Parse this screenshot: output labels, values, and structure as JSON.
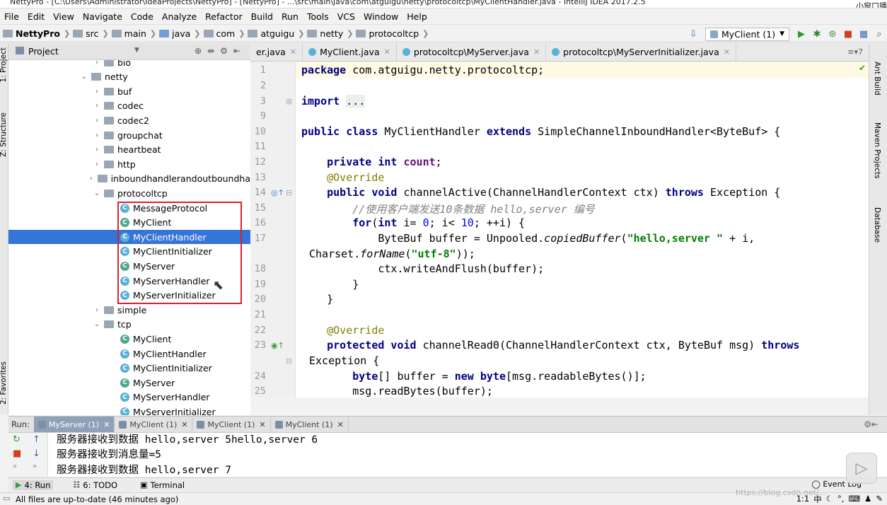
{
  "window": {
    "title": "NettyPro - [C:\\Users\\Administrator\\IdeaProjects\\NettyPro] - [NettyPro] - ...\\src\\main\\java\\com\\atguigu\\netty\\protocoltcp\\MyClientHandler.java - IntelliJ IDEA 2017.2.5",
    "corner_label": "小窗口播"
  },
  "menu": [
    "File",
    "Edit",
    "View",
    "Navigate",
    "Code",
    "Analyze",
    "Refactor",
    "Build",
    "Run",
    "Tools",
    "VCS",
    "Window",
    "Help"
  ],
  "breadcrumb": [
    "NettyPro",
    "src",
    "main",
    "java",
    "com",
    "atguigu",
    "netty",
    "protocoltcp"
  ],
  "toolbar": {
    "run_config": "MyClient (1)"
  },
  "left_tools": {
    "project_tab": "1: Project",
    "structure_tab": "Z: Structure",
    "favorites_tab": "2: Favorites"
  },
  "project_panel": {
    "title": "Project",
    "tree": [
      {
        "label": "bio",
        "type": "folder",
        "depth": 2,
        "expanded": false
      },
      {
        "label": "netty",
        "type": "folder",
        "depth": 1,
        "expanded": true
      },
      {
        "label": "buf",
        "type": "folder",
        "depth": 2,
        "expanded": false
      },
      {
        "label": "codec",
        "type": "folder",
        "depth": 2,
        "expanded": false
      },
      {
        "label": "codec2",
        "type": "folder",
        "depth": 2,
        "expanded": false
      },
      {
        "label": "groupchat",
        "type": "folder",
        "depth": 2,
        "expanded": false
      },
      {
        "label": "heartbeat",
        "type": "folder",
        "depth": 2,
        "expanded": false
      },
      {
        "label": "http",
        "type": "folder",
        "depth": 2,
        "expanded": false
      },
      {
        "label": "inboundhandlerandoutboundha",
        "type": "folder",
        "depth": 2,
        "expanded": false
      },
      {
        "label": "protocoltcp",
        "type": "folder",
        "depth": 2,
        "expanded": true
      },
      {
        "label": "MessageProtocol",
        "type": "class",
        "depth": 3
      },
      {
        "label": "MyClient",
        "type": "runclass",
        "depth": 3
      },
      {
        "label": "MyClientHandler",
        "type": "class",
        "depth": 3,
        "selected": true
      },
      {
        "label": "MyClientInitializer",
        "type": "class",
        "depth": 3
      },
      {
        "label": "MyServer",
        "type": "runclass",
        "depth": 3
      },
      {
        "label": "MyServerHandler",
        "type": "class",
        "depth": 3
      },
      {
        "label": "MyServerInitializer",
        "type": "class",
        "depth": 3
      },
      {
        "label": "simple",
        "type": "folder",
        "depth": 2,
        "expanded": false
      },
      {
        "label": "tcp",
        "type": "folder",
        "depth": 2,
        "expanded": true
      },
      {
        "label": "MyClient",
        "type": "runclass",
        "depth": 3
      },
      {
        "label": "MyClientHandler",
        "type": "class",
        "depth": 3
      },
      {
        "label": "MyClientInitializer",
        "type": "class",
        "depth": 3
      },
      {
        "label": "MyServer",
        "type": "runclass",
        "depth": 3
      },
      {
        "label": "MyServerHandler",
        "type": "class",
        "depth": 3
      },
      {
        "label": "MyServerInitializer",
        "type": "class",
        "depth": 3
      }
    ]
  },
  "editor_tabs": [
    {
      "label": "er.java",
      "active": false
    },
    {
      "label": "MyClient.java",
      "active": false
    },
    {
      "label": "protocoltcp\\MyServer.java",
      "active": false
    },
    {
      "label": "protocoltcp\\MyServerInitializer.java",
      "active": false
    }
  ],
  "editor": {
    "line_numbers": [
      "1",
      "2",
      "3",
      "9",
      "10",
      "11",
      "12",
      "13",
      "14",
      "15",
      "16",
      "17",
      "",
      "18",
      "19",
      "20",
      "21",
      "22",
      "23",
      "",
      "24",
      "25"
    ]
  },
  "right_tools": [
    "Ant Build",
    "Maven Projects",
    "Database"
  ],
  "run_panel": {
    "label": "Run:",
    "tabs": [
      "MyServer (1)",
      "MyClient (1)",
      "MyClient (1)",
      "MyClient (1)"
    ],
    "console": [
      "服务器接收到数据 hello,server 5hello,server 6",
      "服务器接收到消息量=5",
      "服务器接收到数据 hello,server 7"
    ]
  },
  "tool_windows": [
    "4: Run",
    "6: TODO",
    "Terminal"
  ],
  "event_log": "Event Log",
  "status": {
    "message": "All files are up-to-date (46 minutes ago)",
    "position": "1:1",
    "ime": "中"
  },
  "watermark": "https://blog.csdn.net/..."
}
